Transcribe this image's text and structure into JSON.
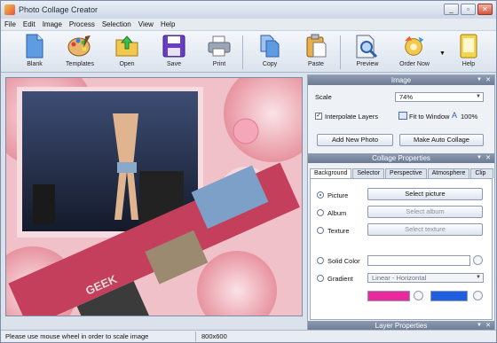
{
  "app": {
    "title": "Photo Collage Creator",
    "window_buttons": {
      "minimize": "_",
      "restore": "▫",
      "close": "✕"
    }
  },
  "menu": [
    "File",
    "Edit",
    "Image",
    "Process",
    "Selection",
    "View",
    "Help"
  ],
  "toolbar": {
    "blank": "Blank",
    "templates": "Templates",
    "open": "Open",
    "save": "Save",
    "print": "Print",
    "copy": "Copy",
    "paste": "Paste",
    "preview": "Preview",
    "order_now": "Order Now",
    "help": "Help"
  },
  "canvas": {
    "background_color": "#f3c9d0",
    "photo_text": "GEEK"
  },
  "image_panel": {
    "title": "Image",
    "scale_label": "Scale",
    "scale_value": "74%",
    "interpolate_label": "Interpolate Layers",
    "interpolate_checked": true,
    "fit_to_window": "Fit to Window",
    "zoom_100": "100%",
    "add_new_photo": "Add New Photo",
    "make_auto_collage": "Make Auto Collage"
  },
  "collage_properties": {
    "title": "Collage Properties",
    "tabs": [
      "Background",
      "Selector",
      "Perspective",
      "Atmosphere",
      "Clip Art"
    ],
    "active_tab": "Background",
    "picture_label": "Picture",
    "select_picture": "Select picture",
    "album_label": "Album",
    "select_album": "Select album",
    "texture_label": "Texture",
    "select_texture": "Select texture",
    "solid_color_label": "Solid Color",
    "gradient_label": "Gradient",
    "gradient_type": "Linear - Horizontal",
    "gradient_color1": "#ea2a9c",
    "gradient_color2": "#1f5fe0"
  },
  "layer_properties": {
    "title": "Layer Properties"
  },
  "status": {
    "hint": "Please use mouse wheel in order to scale image",
    "size": "800x600"
  }
}
